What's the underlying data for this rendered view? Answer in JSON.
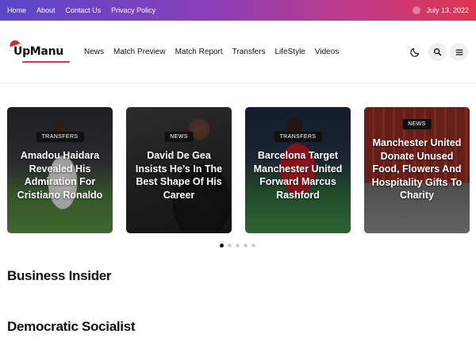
{
  "topbar": {
    "links": [
      "Home",
      "About",
      "Contact Us",
      "Privacy Policy"
    ],
    "date": "July 13, 2022"
  },
  "header": {
    "logo_text": "UpManu",
    "nav": [
      "News",
      "Match Preview",
      "Match Report",
      "Transfers",
      "LifeStyle",
      "Videos"
    ],
    "icons": [
      "moon-icon",
      "search-icon",
      "menu-icon"
    ]
  },
  "slider": {
    "cards": [
      {
        "badge": "Transfers",
        "title": "Amadou Haidara Revealed His Admiration For Cristiano Ronaldo"
      },
      {
        "badge": "News",
        "title": "David De Gea Insists He’s In The Best Shape Of His Career"
      },
      {
        "badge": "Transfers",
        "title": "Barcelona Target Manchester United Forward Marcus Rashford"
      },
      {
        "badge": "News",
        "title": "Manchester United Donate Unused Food, Flowers And Hospitality Gifts To Charity"
      }
    ],
    "pagination": {
      "count": 5,
      "active_index": 0
    }
  },
  "sections": [
    "Business Insider",
    "Democratic Socialist"
  ],
  "colors": {
    "accent": "#e0344f",
    "gradient_start": "#5a47c9",
    "gradient_end": "#e0344f"
  }
}
